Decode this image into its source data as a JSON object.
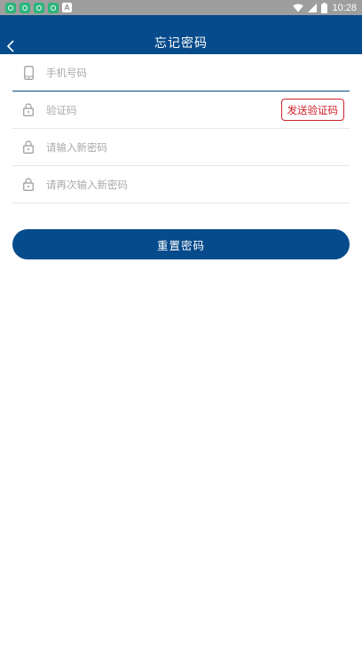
{
  "status_bar": {
    "time": "10:28",
    "notification_icons": [
      "app-notification-icon",
      "app-notification-icon",
      "app-notification-icon",
      "app-notification-icon",
      "a-notification-icon"
    ],
    "system_icons": [
      "wifi-icon",
      "signal-icon",
      "battery-icon"
    ]
  },
  "header": {
    "title": "忘记密码",
    "back_icon": "chevron-left-icon"
  },
  "form": {
    "phone": {
      "placeholder": "手机号码",
      "value": "",
      "icon": "phone-icon"
    },
    "code": {
      "placeholder": "验证码",
      "value": "",
      "icon": "lock-icon",
      "send_label": "发送验证码"
    },
    "new_password": {
      "placeholder": "请输入新密码",
      "value": "",
      "icon": "lock-icon"
    },
    "confirm_password": {
      "placeholder": "请再次输入新密码",
      "value": "",
      "icon": "lock-icon"
    }
  },
  "submit_label": "重置密码",
  "colors": {
    "primary": "#064b8b",
    "accent_red": "#d0202a",
    "status_bar": "#9e9e9e",
    "placeholder": "#aaaaaa"
  }
}
